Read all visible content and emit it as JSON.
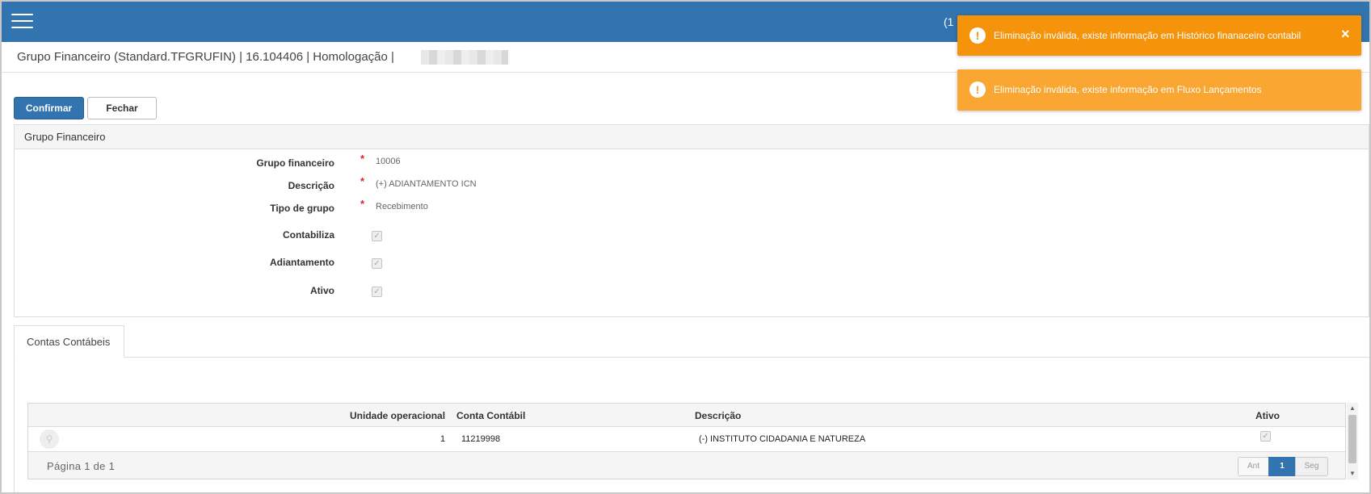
{
  "header": {
    "menu_icon": "hamburger-menu-icon",
    "right_text": "(1"
  },
  "title": {
    "text": "Grupo Financeiro (Standard.TFGRUFIN) | 16.104406 | Homologação |"
  },
  "toolbar": {
    "confirm_label": "Confirmar",
    "close_label": "Fechar"
  },
  "form": {
    "panel_title": "Grupo Financeiro",
    "required_mark": "*",
    "fields": {
      "grupo": {
        "label": "Grupo financeiro",
        "value": "10006"
      },
      "descricao": {
        "label": "Descrição",
        "value": "(+) ADIANTAMENTO ICN"
      },
      "tipo": {
        "label": "Tipo de grupo",
        "value": "Recebimento"
      },
      "contabiliza": {
        "label": "Contabiliza",
        "checked": true
      },
      "adiantamento": {
        "label": "Adiantamento",
        "checked": true
      },
      "ativo": {
        "label": "Ativo",
        "checked": true
      }
    }
  },
  "tabs": {
    "contas": "Contas Contábeis"
  },
  "grid": {
    "columns": {
      "unidade": "Unidade operacional",
      "conta": "Conta Contábil",
      "descricao": "Descrição",
      "ativo": "Ativo"
    },
    "rows": [
      {
        "unidade": "1",
        "conta": "11219998",
        "descricao": "(-) INSTITUTO CIDADANIA E NATUREZA",
        "ativo": true
      }
    ],
    "footer": {
      "page_info": "Página 1 de 1",
      "prev": "Ant",
      "current": "1",
      "next": "Seg"
    }
  },
  "notifications": [
    {
      "text": "Eliminação inválida, existe informação em Histórico finanaceiro contabil",
      "icon": "exclamation-icon",
      "color": "#f5930a",
      "closable": true
    },
    {
      "text": "Eliminação inválida, existe informação em Fluxo Lançamentos",
      "icon": "exclamation-icon",
      "color": "#f9a633",
      "closable": false
    }
  ],
  "symbols": {
    "close": "×",
    "exclamation": "!",
    "check": "✓",
    "search": "⚲",
    "up": "▲",
    "down": "▼"
  }
}
